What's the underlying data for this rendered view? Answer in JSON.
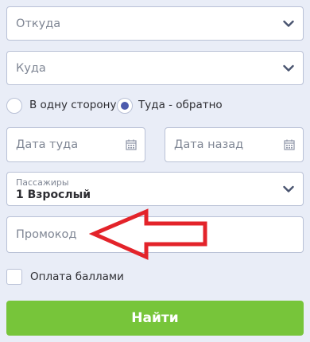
{
  "from_select": {
    "placeholder": "Откуда",
    "icon": "chevron-down-icon"
  },
  "to_select": {
    "placeholder": "Куда",
    "icon": "chevron-down-icon"
  },
  "trip_type": {
    "selected": "round-trip",
    "options": [
      {
        "id": "one-way",
        "label": "В одну сторону",
        "selected": false
      },
      {
        "id": "round-trip",
        "label": "Туда - обратно",
        "selected": true
      }
    ]
  },
  "dates": {
    "depart": {
      "placeholder": "Дата туда",
      "icon": "calendar-icon"
    },
    "return": {
      "placeholder": "Дата назад",
      "icon": "calendar-icon"
    }
  },
  "passengers": {
    "label": "Пассажиры",
    "value": "1 Взрослый",
    "icon": "chevron-down-icon"
  },
  "promo": {
    "placeholder": "Промокод"
  },
  "annotation": {
    "type": "red-arrow-pointing-left",
    "color": "#e3232a"
  },
  "points_payment": {
    "label": "Оплата баллами",
    "checked": false
  },
  "search_button": {
    "label": "Найти"
  },
  "colors": {
    "background": "#e9edf7",
    "field_border": "#b9c1d6",
    "placeholder_text": "#7f8694",
    "radio_selected": "#4d5bad",
    "button_green": "#77c53a",
    "arrow_red": "#e3232a"
  }
}
